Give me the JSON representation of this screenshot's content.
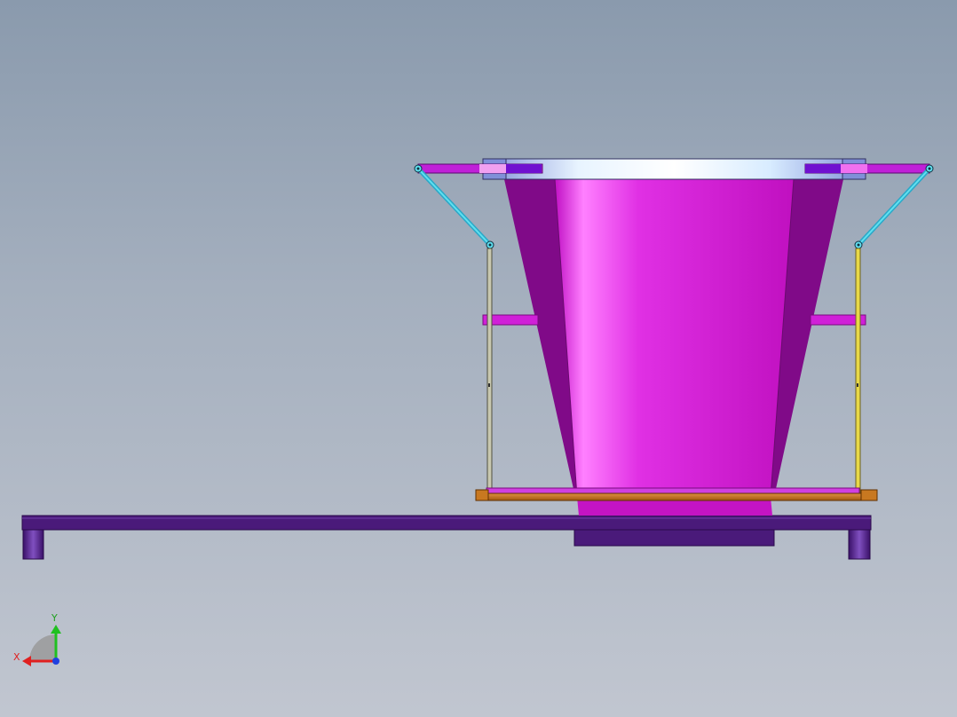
{
  "view": {
    "background_top": "#8a9aad",
    "background_bottom": "#c1c6d0"
  },
  "model": {
    "hopper_color": "#c414c4",
    "hopper_shadow_color": "#7a0a80",
    "rim_color": "#dfefff",
    "frame_color": "#4a1a7a",
    "link_color": "#3cc8e0",
    "rod_left_color": "#c8c8b0",
    "rod_right_color": "#e8d848",
    "tray_color": "#c87820"
  },
  "triad": {
    "x_label": "X",
    "y_label": "Y",
    "x_color": "#e02020",
    "y_color": "#20c020",
    "z_color": "#2040e0"
  }
}
